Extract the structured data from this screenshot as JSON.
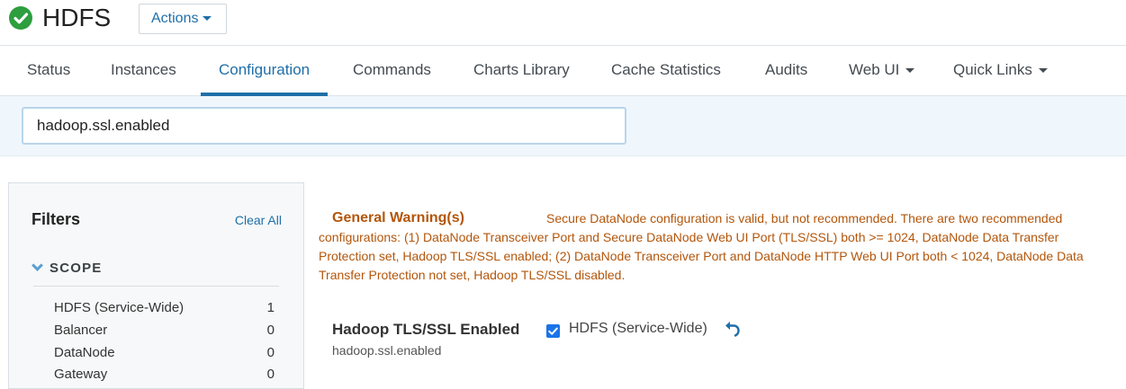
{
  "header": {
    "service_name": "HDFS",
    "status_icon": "check-circle-icon",
    "actions_label": "Actions"
  },
  "tabs": [
    {
      "label": "Status",
      "active": false
    },
    {
      "label": "Instances",
      "active": false
    },
    {
      "label": "Configuration",
      "active": true
    },
    {
      "label": "Commands",
      "active": false
    },
    {
      "label": "Charts Library",
      "active": false
    },
    {
      "label": "Cache Statistics",
      "active": false
    },
    {
      "label": "Audits",
      "active": false
    },
    {
      "label": "Web UI",
      "active": false,
      "dropdown": true
    },
    {
      "label": "Quick Links",
      "active": false,
      "dropdown": true
    }
  ],
  "search": {
    "value": "hadoop.ssl.enabled"
  },
  "filters": {
    "title": "Filters",
    "clear_all": "Clear All",
    "scope_label": "SCOPE",
    "scope_items": [
      {
        "label": "HDFS (Service-Wide)",
        "count": "1"
      },
      {
        "label": "Balancer",
        "count": "0"
      },
      {
        "label": "DataNode",
        "count": "0"
      },
      {
        "label": "Gateway",
        "count": "0"
      }
    ]
  },
  "warning": {
    "title": "General Warning(s)",
    "message": "Secure DataNode configuration is valid, but not recommended. There are two recommended configurations: (1) DataNode Transceiver Port and Secure DataNode Web UI Port (TLS/SSL) both >= 1024, DataNode Data Transfer Protection set, Hadoop TLS/SSL enabled; (2) DataNode Transceiver Port and DataNode HTTP Web UI Port both < 1024, DataNode Data Transfer Protection not set, Hadoop TLS/SSL disabled."
  },
  "property": {
    "display_name": "Hadoop TLS/SSL Enabled",
    "key": "hadoop.ssl.enabled",
    "scope_label": "HDFS (Service-Wide)",
    "checked": true,
    "undo_icon": "undo-arrow-icon"
  },
  "colors": {
    "accent": "#1f6fa8",
    "warning": "#b3560b",
    "success": "#2e9e3e"
  }
}
